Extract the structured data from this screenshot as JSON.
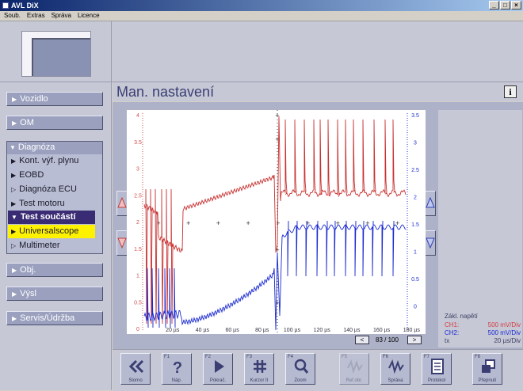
{
  "window": {
    "title": "AVL DiX",
    "controls": [
      "_",
      "□",
      "×"
    ]
  },
  "menu": [
    "Soub.",
    "Extras",
    "Správa",
    "Licence"
  ],
  "sidebar": {
    "buttons": [
      {
        "label": "Vozidlo"
      },
      {
        "label": "OM"
      },
      {
        "label": "Obj."
      },
      {
        "label": "Výsl"
      },
      {
        "label": "Servis/Údržba"
      }
    ],
    "diagnosis": {
      "label": "Diagnóza",
      "items": [
        {
          "label": "Kont. výf. plynu",
          "state": "normal"
        },
        {
          "label": "EOBD",
          "state": "normal"
        },
        {
          "label": "Diagnóza ECU",
          "state": "dim"
        },
        {
          "label": "Test motoru",
          "state": "normal"
        },
        {
          "label": "Test součástí",
          "state": "selected"
        },
        {
          "label": "Universalscope",
          "state": "highlighted"
        },
        {
          "label": "Multimeter",
          "state": "dim"
        }
      ]
    }
  },
  "header": {
    "title": "Man. nastavení",
    "info_icon": "info-icon",
    "info_glyph": "i"
  },
  "scope": {
    "colors": {
      "ch1": "#c83030",
      "ch2": "#1a2ad0",
      "ch1_axis": "#d05050",
      "ch2_axis": "#2030d0"
    },
    "ch1_axis_ticks": [
      "4",
      "3.5",
      "3",
      "2.5",
      "2",
      "1.5",
      "1",
      "0.5",
      "0"
    ],
    "ch2_axis_ticks": [
      "3.5",
      "3",
      "2.5",
      "2",
      "1.5",
      "1",
      "0.5",
      "0"
    ],
    "x_ticks": [
      "20 µs",
      "40 µs",
      "60 µs",
      "80 µs",
      "100 µs",
      "120 µs",
      "140 µs",
      "160 µs",
      "180 µs"
    ],
    "trigger_marker": "+",
    "pager": {
      "prev": "<",
      "next": ">",
      "text": "83 / 100"
    }
  },
  "info_panel": {
    "heading": "Zákl. napětí",
    "rows": [
      {
        "name": "CH1:",
        "value": "500 mV/Div",
        "color": "#d04040"
      },
      {
        "name": "CH2:",
        "value": "500 mV/Div",
        "color": "#1a2ad0"
      },
      {
        "name": "tx",
        "value": "20  µs/Div",
        "color": "#3a3e60"
      }
    ]
  },
  "toolbar": [
    {
      "fkey": "",
      "label": "Slorno",
      "icon": "double-chevron-left-icon",
      "enabled": true
    },
    {
      "fkey": "F1",
      "label": "Náp.",
      "icon": "question-icon",
      "enabled": true
    },
    {
      "fkey": "F2",
      "label": "Pokrač.",
      "icon": "play-icon",
      "enabled": true
    },
    {
      "fkey": "F3",
      "label": "Kurzor II",
      "icon": "cursor-grid-icon",
      "enabled": true
    },
    {
      "fkey": "F4",
      "label": "Zoom",
      "icon": "zoom-icon",
      "enabled": true
    },
    {
      "fkey": "F5",
      "label": "Ref.obr.",
      "icon": "reference-wave-icon",
      "enabled": false
    },
    {
      "fkey": "F6",
      "label": "Správa",
      "icon": "wave-icon",
      "enabled": true
    },
    {
      "fkey": "F7",
      "label": "Protokol",
      "icon": "document-icon",
      "enabled": true
    },
    {
      "fkey": "F8",
      "label": "Přepnutí",
      "icon": "windows-icon",
      "enabled": true
    }
  ]
}
